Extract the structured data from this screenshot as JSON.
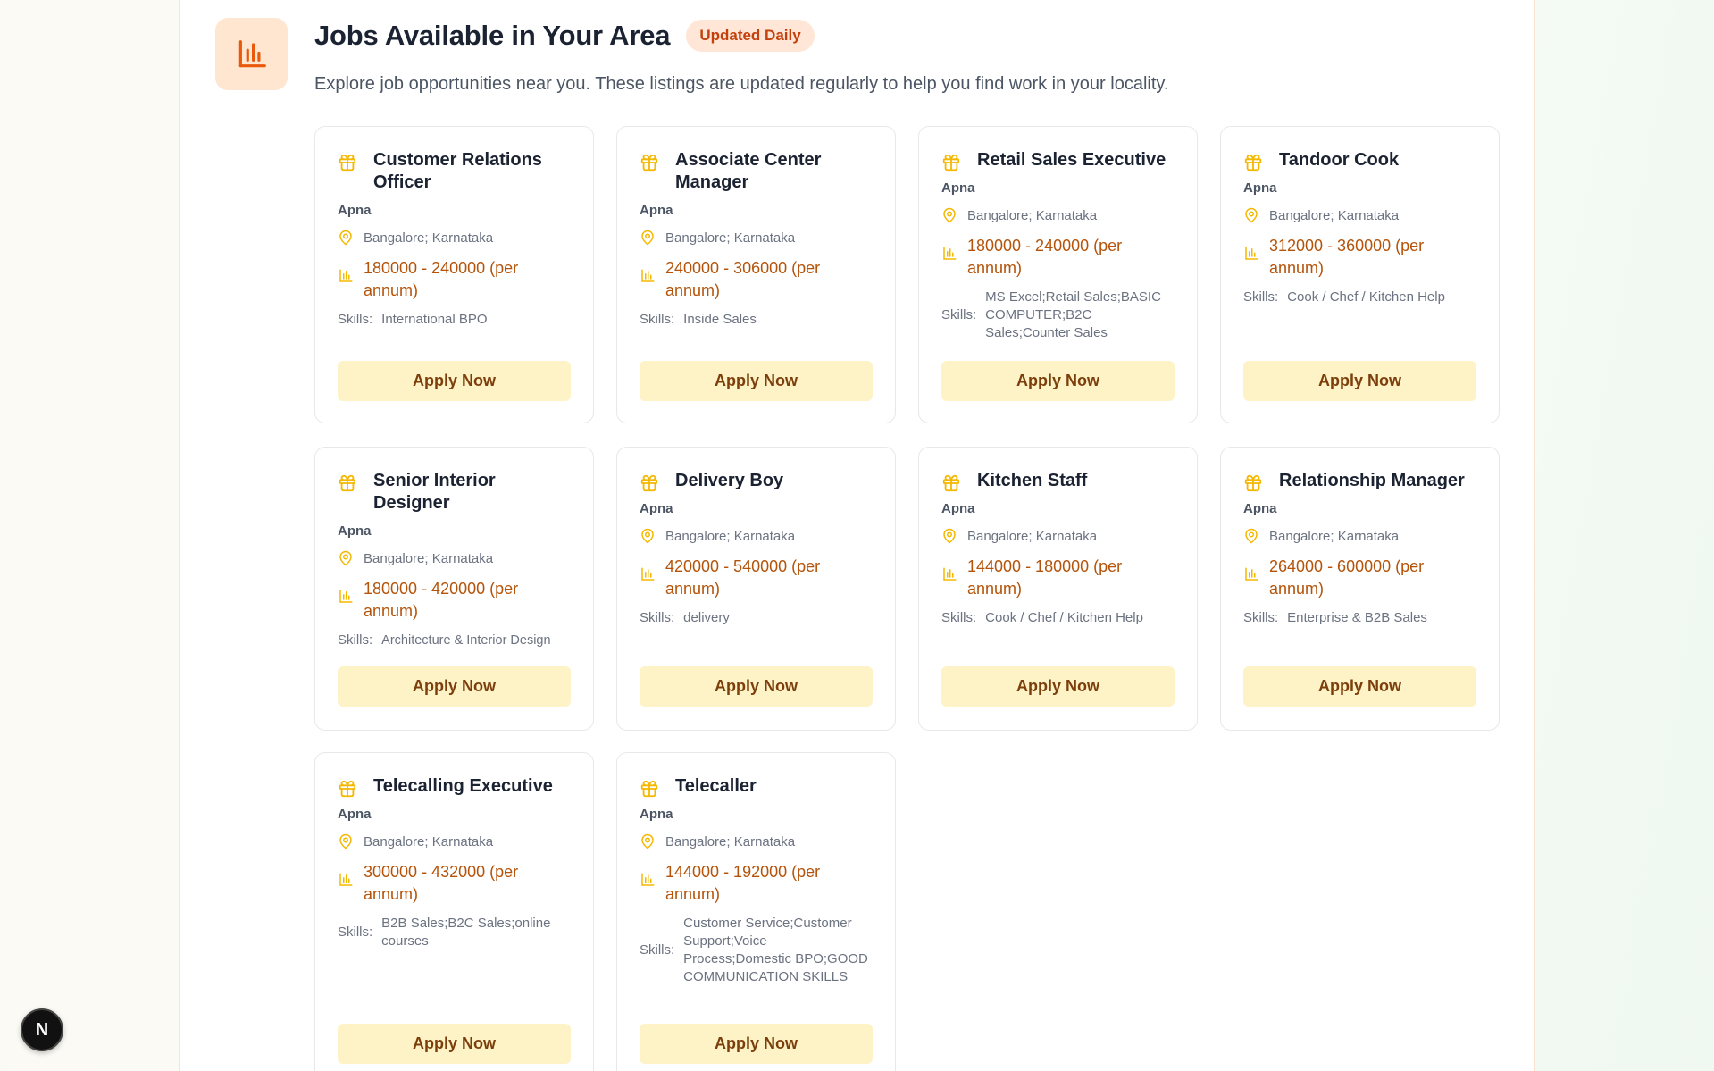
{
  "header": {
    "title": "Jobs Available in Your Area",
    "badge": "Updated Daily",
    "subtitle": "Explore job opportunities near you. These listings are updated regularly to help you find work in your locality.",
    "icon": "bar-chart-icon"
  },
  "colors": {
    "accent_orange": "#ea580c",
    "badge_bg": "#ffe6d6",
    "salary_text": "#b45309",
    "gift_icon": "#f5b800",
    "apply_bg": "#fef3c7"
  },
  "skills_label": "Skills:",
  "apply_label": "Apply Now",
  "jobs": [
    {
      "title": "Customer Relations Officer",
      "company": "Apna",
      "location": "Bangalore; Karnataka",
      "salary": "180000 - 240000 (per annum)",
      "skills": "International BPO"
    },
    {
      "title": "Associate Center Manager",
      "company": "Apna",
      "location": "Bangalore; Karnataka",
      "salary": "240000 - 306000 (per annum)",
      "skills": "Inside Sales"
    },
    {
      "title": "Retail Sales Executive",
      "company": "Apna",
      "location": "Bangalore; Karnataka",
      "salary": "180000 - 240000 (per annum)",
      "skills": "MS Excel;Retail Sales;BASIC COMPUTER;B2C Sales;Counter Sales"
    },
    {
      "title": "Tandoor Cook",
      "company": "Apna",
      "location": "Bangalore; Karnataka",
      "salary": "312000 - 360000 (per annum)",
      "skills": "Cook / Chef / Kitchen Help"
    },
    {
      "title": "Senior Interior Designer",
      "company": "Apna",
      "location": "Bangalore; Karnataka",
      "salary": "180000 - 420000 (per annum)",
      "skills": "Architecture & Interior Design"
    },
    {
      "title": "Delivery Boy",
      "company": "Apna",
      "location": "Bangalore; Karnataka",
      "salary": "420000 - 540000 (per annum)",
      "skills": "delivery"
    },
    {
      "title": "Kitchen Staff",
      "company": "Apna",
      "location": "Bangalore; Karnataka",
      "salary": "144000 - 180000 (per annum)",
      "skills": "Cook / Chef / Kitchen Help"
    },
    {
      "title": "Relationship Manager",
      "company": "Apna",
      "location": "Bangalore; Karnataka",
      "salary": "264000 - 600000 (per annum)",
      "skills": "Enterprise & B2B Sales"
    },
    {
      "title": "Telecalling Executive",
      "company": "Apna",
      "location": "Bangalore; Karnataka",
      "salary": "300000 - 432000 (per annum)",
      "skills": "B2B Sales;B2C Sales;online courses"
    },
    {
      "title": "Telecaller",
      "company": "Apna",
      "location": "Bangalore; Karnataka",
      "salary": "144000 - 192000 (per annum)",
      "skills": "Customer Service;Customer Support;Voice Process;Domestic BPO;GOOD COMMUNICATION SKILLS"
    }
  ],
  "fab": {
    "label": "N",
    "icon": "next-logo-icon"
  }
}
